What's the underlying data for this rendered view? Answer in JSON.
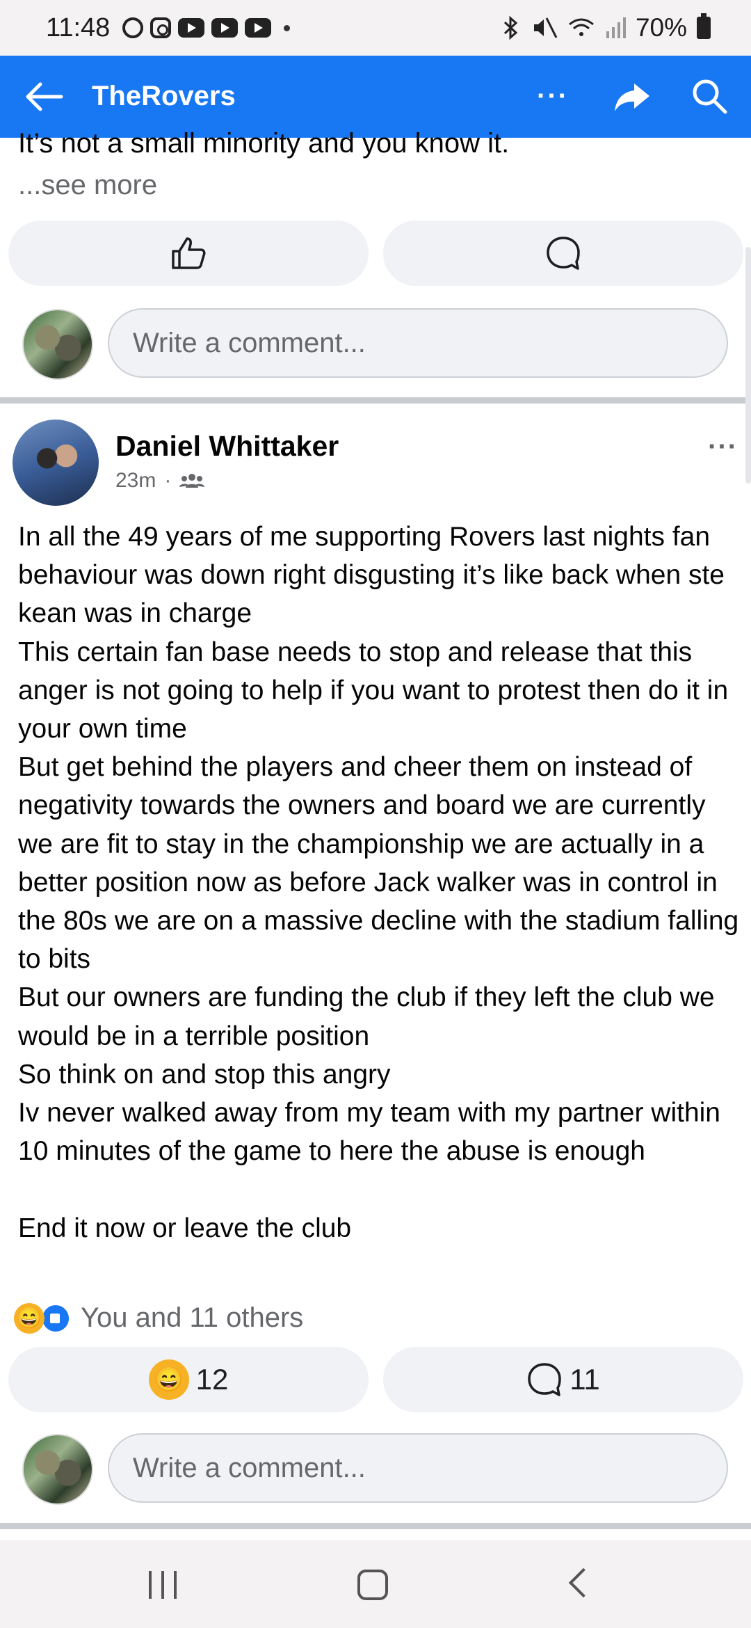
{
  "status_bar": {
    "time": "11:48",
    "battery": "70%"
  },
  "app_bar": {
    "title": "TheRovers",
    "more_icon": "more-horizontal-icon",
    "share_icon": "share-icon",
    "search_icon": "search-icon",
    "color": "#1877f2"
  },
  "prev_post": {
    "tail_text": "It’s not a small minority and you know it.",
    "see_more": "...see more",
    "comment_placeholder": "Write a comment..."
  },
  "post": {
    "author": "Daniel Whittaker",
    "time": "23m",
    "audience_icon": "group-icon",
    "body": "In all the 49 years of me supporting Rovers last nights fan behaviour was down right disgusting it’s like back when ste kean was in charge\nThis certain fan base needs to stop and release that this anger is not going to help if you want to protest then do it in your own time\nBut get behind the players and cheer them on instead of negativity towards the owners and board we are currently we are fit to stay in the championship we are actually in a better position now as before Jack walker was in control in the 80s we are on a massive decline with the stadium falling to bits\nBut our owners are funding the club if they left the club we would be in a terrible position\nSo think on and stop this angry\nIv never walked away from my team with my partner within 10 minutes of the game to here the abuse is enough\n\nEnd it now or leave the club",
    "reactions_text": "You and 11 others",
    "reaction_count": "12",
    "comment_count": "11",
    "comment_placeholder": "Write a comment..."
  }
}
